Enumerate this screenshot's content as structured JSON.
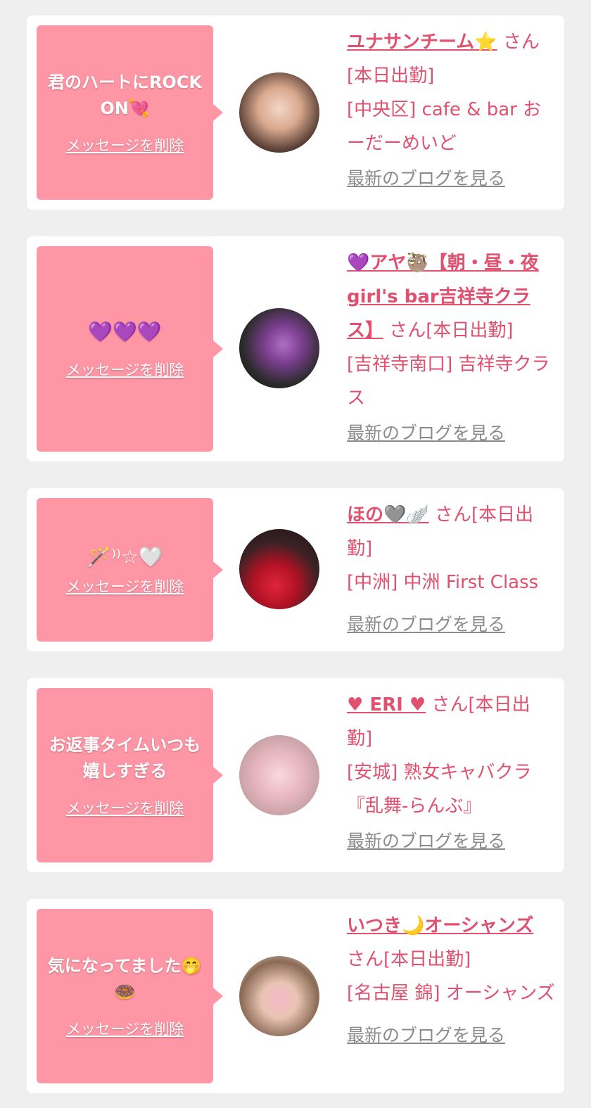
{
  "delete_label": "メッセージを削除",
  "blog_label": "最新のブログを見る",
  "cards": [
    {
      "message": "君のハートにROCK ON💘",
      "name": "ユナサンチーム⭐",
      "status": "さん[本日出勤]",
      "shop": "[中央区] cafe & bar おーだーめいど"
    },
    {
      "message": "💜💜💜",
      "name": "💜アヤ🦥【朝・昼・夜girl's bar吉祥寺クラス】",
      "status": "さん[本日出勤]",
      "shop": "[吉祥寺南口] 吉祥寺クラス"
    },
    {
      "message": "🪄⁾⁾☆🤍",
      "name": "ほの🩶🪽",
      "status": "さん[本日出勤]",
      "shop": "[中洲] 中洲 First Class"
    },
    {
      "message": "お返事タイムいつも嬉しすぎる",
      "name": "♥ ERI ♥",
      "status": "さん[本日出勤]",
      "shop": "[安城] 熟女キャバクラ『乱舞-らんぶ』"
    },
    {
      "message": "気になってました🤭🍩",
      "name": "いつき🌙オーシャンズ",
      "status": "さん[本日出勤]",
      "shop": "[名古屋 錦] オーシャンズ"
    }
  ],
  "colors": {
    "background": "#efefef",
    "bubble": "#ff96a6",
    "accent": "#e2506f",
    "link_gray": "#8a8a8a"
  }
}
